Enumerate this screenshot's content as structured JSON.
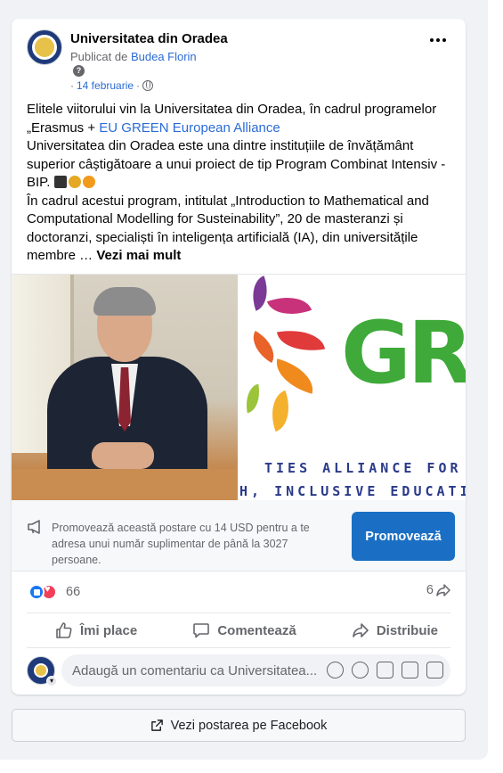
{
  "post": {
    "page_name": "Universitatea din Oradea",
    "published_by_prefix": "Publicat de",
    "author": "Budea Florin",
    "date": "14 februarie",
    "date_dot": "·",
    "help_glyph": "?",
    "text": {
      "line1": "Elitele viitorului vin la Universitatea din Oradea, în cadrul programelor „Erasmus + ",
      "link": "EU GREEN European Alliance",
      "para2": "Universitatea din Oradea este una dintre instituțiile de învățământ superior câștigătoare a unui proiect de tip Program Combinat Intensiv - BIP. ",
      "para3": "În cadrul acestui program, intitulat „Introduction to Mathematical and Computational Modelling for Susteinability”, 20 de masteranzi și doctoranzi, specialiști în inteligența artificială (IA), din universitățile membre … ",
      "see_more": "Vezi mai mult"
    },
    "image_right": {
      "big_letters": "GR",
      "line_a": "TIES ALLIANCE FOR",
      "line_b": "H, INCLUSIVE EDUCATIO"
    }
  },
  "promo": {
    "text": "Promovează această postare cu 14 USD pentru a te adresa unui număr suplimentar de până la 3027 persoane.",
    "button": "Promovează"
  },
  "stats": {
    "reactions": "66",
    "shares": "6"
  },
  "actions": {
    "like": "Îmi place",
    "comment": "Comentează",
    "share": "Distribuie"
  },
  "comment_box": {
    "placeholder": "Adaugă un comentariu ca Universitatea..."
  },
  "footer": {
    "view_on_facebook": "Vezi postarea pe Facebook"
  },
  "colors": {
    "link": "#2b6bd6",
    "promote_button": "#1a6fc4",
    "like_blue": "#1877f2",
    "love_red": "#f33e58"
  },
  "icons": [
    "more-icon",
    "help-icon",
    "globe-icon",
    "megaphone-icon",
    "like-reaction-icon",
    "love-reaction-icon",
    "share-arrow-icon",
    "thumbs-up-icon",
    "comment-bubble-icon",
    "share-icon",
    "avatar-sticker-icon",
    "emoji-icon",
    "camera-icon",
    "gif-icon",
    "sticker-icon",
    "external-link-icon"
  ]
}
